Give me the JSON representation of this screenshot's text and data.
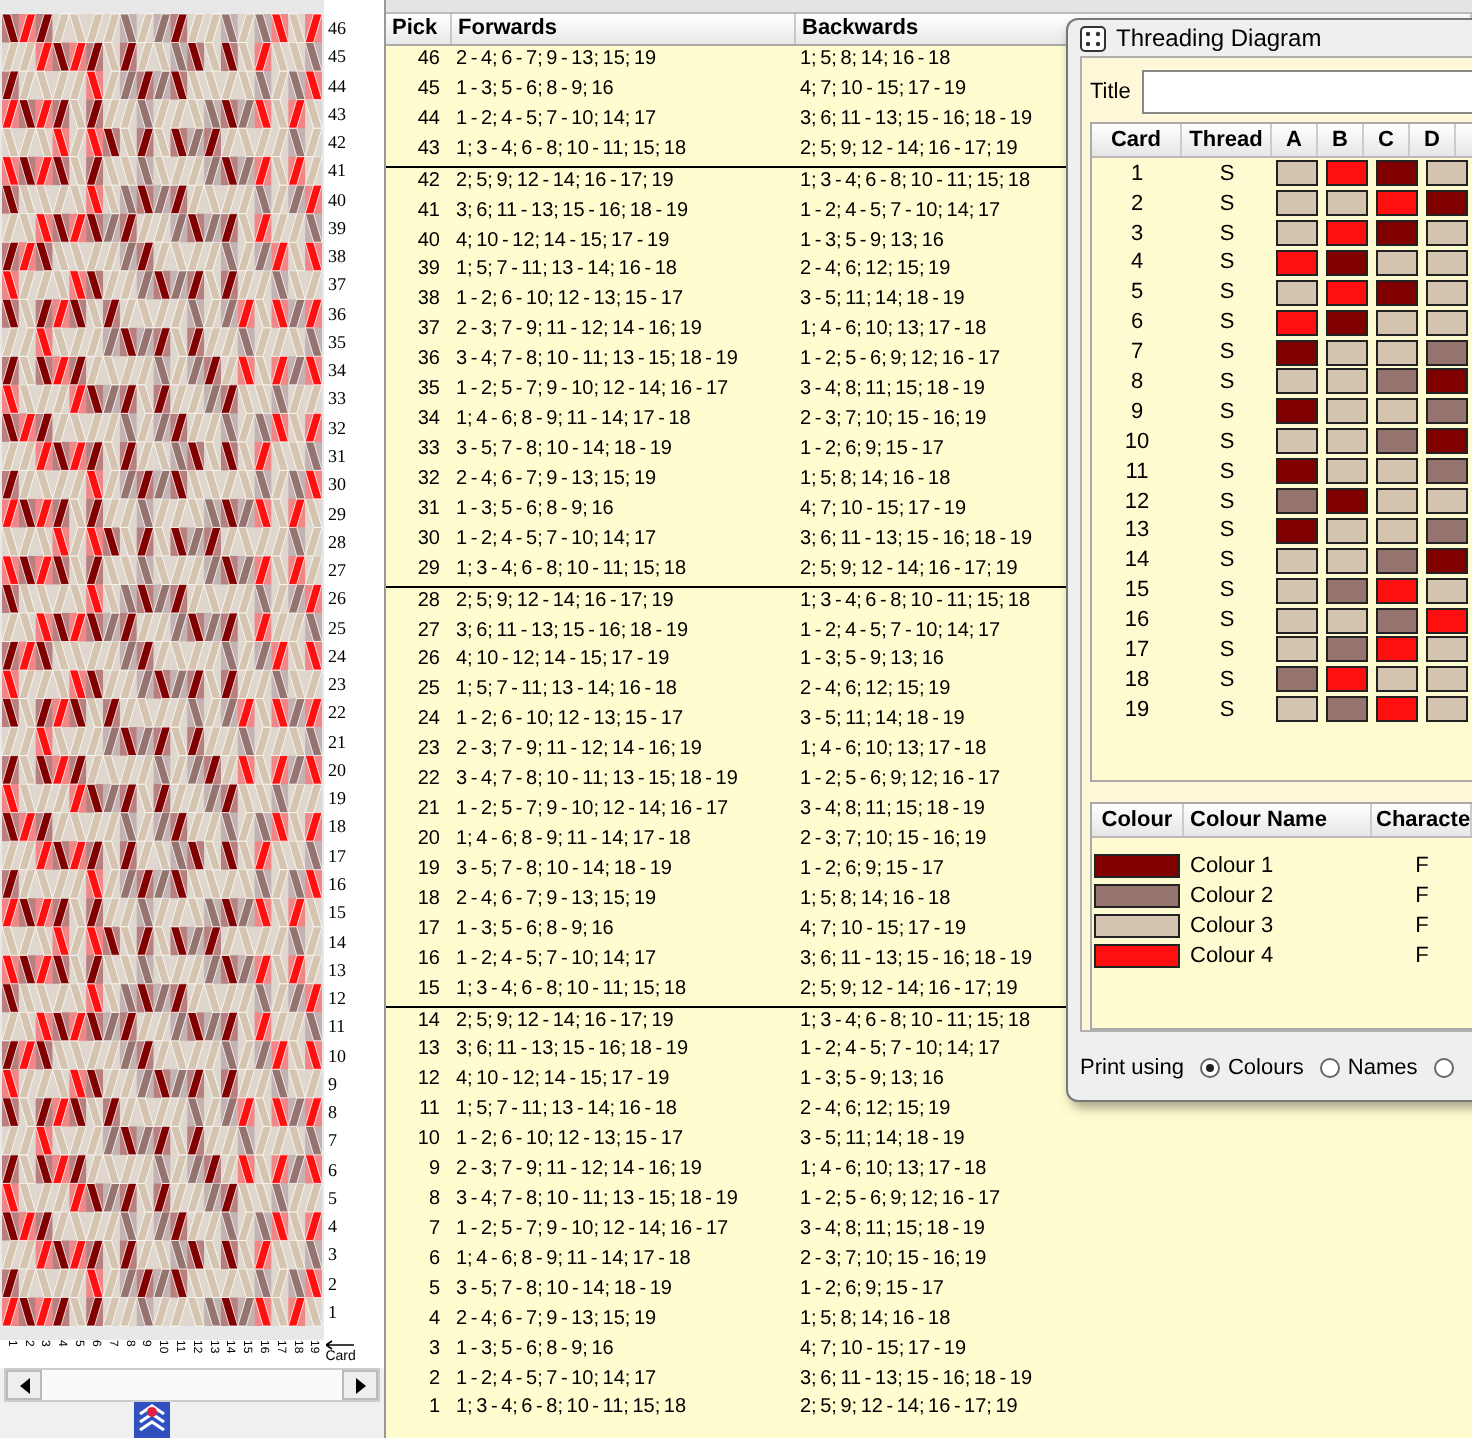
{
  "pattern_panel": {
    "row_labels": [
      "46",
      "45",
      "44",
      "43",
      "42",
      "41",
      "40",
      "39",
      "38",
      "37",
      "36",
      "35",
      "34",
      "33",
      "32",
      "31",
      "30",
      "29",
      "28",
      "27",
      "26",
      "25",
      "24",
      "23",
      "22",
      "21",
      "20",
      "19",
      "18",
      "17",
      "16",
      "15",
      "14",
      "13",
      "12",
      "11",
      "10",
      "9",
      "8",
      "7",
      "6",
      "5",
      "4",
      "3",
      "2",
      "1"
    ],
    "card_labels": [
      "1",
      "2",
      "3",
      "4",
      "5",
      "6",
      "7",
      "8",
      "9",
      "10",
      "11",
      "12",
      "13",
      "14",
      "15",
      "16",
      "17",
      "18",
      "19"
    ],
    "card_axis_label": "Card"
  },
  "pick_table": {
    "columns": [
      "Pick",
      "Forwards",
      "Backwards"
    ],
    "row_groups": [
      [
        {
          "pick": "46",
          "forwards": "2 - 4; 6 - 7; 9 - 13; 15; 19",
          "backwards": "1; 5; 8; 14; 16 - 18"
        },
        {
          "pick": "45",
          "forwards": "1 - 3; 5 - 6; 8 - 9; 16",
          "backwards": "4; 7; 10 - 15; 17 - 19"
        },
        {
          "pick": "44",
          "forwards": "1 - 2; 4 - 5; 7 - 10; 14; 17",
          "backwards": "3; 6; 11 - 13; 15 - 16; 18 - 19"
        },
        {
          "pick": "43",
          "forwards": "1; 3 - 4; 6 - 8; 10 - 11; 15; 18",
          "backwards": "2; 5; 9; 12 - 14; 16 - 17; 19"
        }
      ],
      [
        {
          "pick": "42",
          "forwards": "2; 5; 9; 12 - 14; 16 - 17; 19",
          "backwards": "1; 3 - 4; 6 - 8; 10 - 11; 15; 18"
        },
        {
          "pick": "41",
          "forwards": "3; 6; 11 - 13; 15 - 16; 18 - 19",
          "backwards": "1 - 2; 4 - 5; 7 - 10; 14; 17"
        },
        {
          "pick": "40",
          "forwards": "4; 10 - 12; 14 - 15; 17 - 19",
          "backwards": "1 - 3; 5 - 9; 13; 16"
        },
        {
          "pick": "39",
          "forwards": "1; 5; 7 - 11; 13 - 14; 16 - 18",
          "backwards": "2 - 4; 6; 12; 15; 19"
        },
        {
          "pick": "38",
          "forwards": "1 - 2; 6 - 10; 12 - 13; 15 - 17",
          "backwards": "3 - 5; 11; 14; 18 - 19"
        },
        {
          "pick": "37",
          "forwards": "2 - 3; 7 - 9; 11 - 12; 14 - 16; 19",
          "backwards": "1; 4 - 6; 10; 13; 17 - 18"
        },
        {
          "pick": "36",
          "forwards": "3 - 4; 7 - 8; 10 - 11; 13 - 15; 18 - 19",
          "backwards": "1 - 2; 5 - 6; 9; 12; 16 - 17"
        },
        {
          "pick": "35",
          "forwards": "1 - 2; 5 - 7; 9 - 10; 12 - 14; 16 - 17",
          "backwards": "3 - 4; 8; 11; 15; 18 - 19"
        },
        {
          "pick": "34",
          "forwards": "1; 4 - 6; 8 - 9; 11 - 14; 17 - 18",
          "backwards": "2 - 3; 7; 10; 15 - 16; 19"
        },
        {
          "pick": "33",
          "forwards": "3 - 5; 7 - 8; 10 - 14; 18 - 19",
          "backwards": "1 - 2; 6; 9; 15 - 17"
        },
        {
          "pick": "32",
          "forwards": "2 - 4; 6 - 7; 9 - 13; 15; 19",
          "backwards": "1; 5; 8; 14; 16 - 18"
        },
        {
          "pick": "31",
          "forwards": "1 - 3; 5 - 6; 8 - 9; 16",
          "backwards": "4; 7; 10 - 15; 17 - 19"
        },
        {
          "pick": "30",
          "forwards": "1 - 2; 4 - 5; 7 - 10; 14; 17",
          "backwards": "3; 6; 11 - 13; 15 - 16; 18 - 19"
        },
        {
          "pick": "29",
          "forwards": "1; 3 - 4; 6 - 8; 10 - 11; 15; 18",
          "backwards": "2; 5; 9; 12 - 14; 16 - 17; 19"
        }
      ],
      [
        {
          "pick": "28",
          "forwards": "2; 5; 9; 12 - 14; 16 - 17; 19",
          "backwards": "1; 3 - 4; 6 - 8; 10 - 11; 15; 18"
        },
        {
          "pick": "27",
          "forwards": "3; 6; 11 - 13; 15 - 16; 18 - 19",
          "backwards": "1 - 2; 4 - 5; 7 - 10; 14; 17"
        },
        {
          "pick": "26",
          "forwards": "4; 10 - 12; 14 - 15; 17 - 19",
          "backwards": "1 - 3; 5 - 9; 13; 16"
        },
        {
          "pick": "25",
          "forwards": "1; 5; 7 - 11; 13 - 14; 16 - 18",
          "backwards": "2 - 4; 6; 12; 15; 19"
        },
        {
          "pick": "24",
          "forwards": "1 - 2; 6 - 10; 12 - 13; 15 - 17",
          "backwards": "3 - 5; 11; 14; 18 - 19"
        },
        {
          "pick": "23",
          "forwards": "2 - 3; 7 - 9; 11 - 12; 14 - 16; 19",
          "backwards": "1; 4 - 6; 10; 13; 17 - 18"
        },
        {
          "pick": "22",
          "forwards": "3 - 4; 7 - 8; 10 - 11; 13 - 15; 18 - 19",
          "backwards": "1 - 2; 5 - 6; 9; 12; 16 - 17"
        },
        {
          "pick": "21",
          "forwards": "1 - 2; 5 - 7; 9 - 10; 12 - 14; 16 - 17",
          "backwards": "3 - 4; 8; 11; 15; 18 - 19"
        },
        {
          "pick": "20",
          "forwards": "1; 4 - 6; 8 - 9; 11 - 14; 17 - 18",
          "backwards": "2 - 3; 7; 10; 15 - 16; 19"
        },
        {
          "pick": "19",
          "forwards": "3 - 5; 7 - 8; 10 - 14; 18 - 19",
          "backwards": "1 - 2; 6; 9; 15 - 17"
        },
        {
          "pick": "18",
          "forwards": "2 - 4; 6 - 7; 9 - 13; 15; 19",
          "backwards": "1; 5; 8; 14; 16 - 18"
        },
        {
          "pick": "17",
          "forwards": "1 - 3; 5 - 6; 8 - 9; 16",
          "backwards": "4; 7; 10 - 15; 17 - 19"
        },
        {
          "pick": "16",
          "forwards": "1 - 2; 4 - 5; 7 - 10; 14; 17",
          "backwards": "3; 6; 11 - 13; 15 - 16; 18 - 19"
        },
        {
          "pick": "15",
          "forwards": "1; 3 - 4; 6 - 8; 10 - 11; 15; 18",
          "backwards": "2; 5; 9; 12 - 14; 16 - 17; 19"
        }
      ],
      [
        {
          "pick": "14",
          "forwards": "2; 5; 9; 12 - 14; 16 - 17; 19",
          "backwards": "1; 3 - 4; 6 - 8; 10 - 11; 15; 18"
        },
        {
          "pick": "13",
          "forwards": "3; 6; 11 - 13; 15 - 16; 18 - 19",
          "backwards": "1 - 2; 4 - 5; 7 - 10; 14; 17"
        },
        {
          "pick": "12",
          "forwards": "4; 10 - 12; 14 - 15; 17 - 19",
          "backwards": "1 - 3; 5 - 9; 13; 16"
        },
        {
          "pick": "11",
          "forwards": "1; 5; 7 - 11; 13 - 14; 16 - 18",
          "backwards": "2 - 4; 6; 12; 15; 19"
        },
        {
          "pick": "10",
          "forwards": "1 - 2; 6 - 10; 12 - 13; 15 - 17",
          "backwards": "3 - 5; 11; 14; 18 - 19"
        },
        {
          "pick": "9",
          "forwards": "2 - 3; 7 - 9; 11 - 12; 14 - 16; 19",
          "backwards": "1; 4 - 6; 10; 13; 17 - 18"
        },
        {
          "pick": "8",
          "forwards": "3 - 4; 7 - 8; 10 - 11; 13 - 15; 18 - 19",
          "backwards": "1 - 2; 5 - 6; 9; 12; 16 - 17"
        },
        {
          "pick": "7",
          "forwards": "1 - 2; 5 - 7; 9 - 10; 12 - 14; 16 - 17",
          "backwards": "3 - 4; 8; 11; 15; 18 - 19"
        },
        {
          "pick": "6",
          "forwards": "1; 4 - 6; 8 - 9; 11 - 14; 17 - 18",
          "backwards": "2 - 3; 7; 10; 15 - 16; 19"
        },
        {
          "pick": "5",
          "forwards": "3 - 5; 7 - 8; 10 - 14; 18 - 19",
          "backwards": "1 - 2; 6; 9; 15 - 17"
        },
        {
          "pick": "4",
          "forwards": "2 - 4; 6 - 7; 9 - 13; 15; 19",
          "backwards": "1; 5; 8; 14; 16 - 18"
        },
        {
          "pick": "3",
          "forwards": "1 - 3; 5 - 6; 8 - 9; 16",
          "backwards": "4; 7; 10 - 15; 17 - 19"
        },
        {
          "pick": "2",
          "forwards": "1 - 2; 4 - 5; 7 - 10; 14; 17",
          "backwards": "3; 6; 11 - 13; 15 - 16; 18 - 19"
        },
        {
          "pick": "1",
          "forwards": "1; 3 - 4; 6 - 8; 10 - 11; 15; 18",
          "backwards": "2; 5; 9; 12 - 14; 16 - 17; 19"
        }
      ]
    ]
  },
  "threading_dialog": {
    "title": "Threading Diagram",
    "title_field": {
      "label": "Title"
    },
    "cards_table": {
      "columns": [
        "Card",
        "Thread",
        "A",
        "B",
        "C",
        "D"
      ],
      "rows": [
        {
          "card": "1",
          "thread": "S",
          "holes": [
            {
              "color": "#d4c4b0"
            },
            {
              "color": "#ff1010"
            },
            {
              "color": "#800000"
            },
            {
              "color": "#d4c4b0"
            }
          ]
        },
        {
          "card": "2",
          "thread": "S",
          "holes": [
            {
              "color": "#d4c4b0"
            },
            {
              "color": "#d4c4b0"
            },
            {
              "color": "#ff1010"
            },
            {
              "color": "#800000"
            }
          ]
        },
        {
          "card": "3",
          "thread": "S",
          "holes": [
            {
              "color": "#d4c4b0"
            },
            {
              "color": "#ff1010"
            },
            {
              "color": "#800000"
            },
            {
              "color": "#d4c4b0"
            }
          ]
        },
        {
          "card": "4",
          "thread": "S",
          "holes": [
            {
              "color": "#ff1010"
            },
            {
              "color": "#800000"
            },
            {
              "color": "#d4c4b0"
            },
            {
              "color": "#d4c4b0"
            }
          ]
        },
        {
          "card": "5",
          "thread": "S",
          "holes": [
            {
              "color": "#d4c4b0"
            },
            {
              "color": "#ff1010"
            },
            {
              "color": "#800000"
            },
            {
              "color": "#d4c4b0"
            }
          ]
        },
        {
          "card": "6",
          "thread": "S",
          "holes": [
            {
              "color": "#ff1010"
            },
            {
              "color": "#800000"
            },
            {
              "color": "#d4c4b0"
            },
            {
              "color": "#d4c4b0"
            }
          ]
        },
        {
          "card": "7",
          "thread": "S",
          "holes": [
            {
              "color": "#800000"
            },
            {
              "color": "#d4c4b0"
            },
            {
              "color": "#d4c4b0"
            },
            {
              "color": "#957470"
            }
          ]
        },
        {
          "card": "8",
          "thread": "S",
          "holes": [
            {
              "color": "#d4c4b0"
            },
            {
              "color": "#d4c4b0"
            },
            {
              "color": "#957470"
            },
            {
              "color": "#800000"
            }
          ]
        },
        {
          "card": "9",
          "thread": "S",
          "holes": [
            {
              "color": "#800000"
            },
            {
              "color": "#d4c4b0"
            },
            {
              "color": "#d4c4b0"
            },
            {
              "color": "#957470"
            }
          ]
        },
        {
          "card": "10",
          "thread": "S",
          "holes": [
            {
              "color": "#d4c4b0"
            },
            {
              "color": "#d4c4b0"
            },
            {
              "color": "#957470"
            },
            {
              "color": "#800000"
            }
          ]
        },
        {
          "card": "11",
          "thread": "S",
          "holes": [
            {
              "color": "#800000"
            },
            {
              "color": "#d4c4b0"
            },
            {
              "color": "#d4c4b0"
            },
            {
              "color": "#957470"
            }
          ]
        },
        {
          "card": "12",
          "thread": "S",
          "holes": [
            {
              "color": "#957470"
            },
            {
              "color": "#800000"
            },
            {
              "color": "#d4c4b0"
            },
            {
              "color": "#d4c4b0"
            }
          ]
        },
        {
          "card": "13",
          "thread": "S",
          "holes": [
            {
              "color": "#800000"
            },
            {
              "color": "#d4c4b0"
            },
            {
              "color": "#d4c4b0"
            },
            {
              "color": "#957470"
            }
          ]
        },
        {
          "card": "14",
          "thread": "S",
          "holes": [
            {
              "color": "#d4c4b0"
            },
            {
              "color": "#d4c4b0"
            },
            {
              "color": "#957470"
            },
            {
              "color": "#800000"
            }
          ]
        },
        {
          "card": "15",
          "thread": "S",
          "holes": [
            {
              "color": "#d4c4b0"
            },
            {
              "color": "#957470"
            },
            {
              "color": "#ff1010"
            },
            {
              "color": "#d4c4b0"
            }
          ]
        },
        {
          "card": "16",
          "thread": "S",
          "holes": [
            {
              "color": "#d4c4b0"
            },
            {
              "color": "#d4c4b0"
            },
            {
              "color": "#957470"
            },
            {
              "color": "#ff1010"
            }
          ]
        },
        {
          "card": "17",
          "thread": "S",
          "holes": [
            {
              "color": "#d4c4b0"
            },
            {
              "color": "#957470"
            },
            {
              "color": "#ff1010"
            },
            {
              "color": "#d4c4b0"
            }
          ]
        },
        {
          "card": "18",
          "thread": "S",
          "holes": [
            {
              "color": "#957470"
            },
            {
              "color": "#ff1010"
            },
            {
              "color": "#d4c4b0"
            },
            {
              "color": "#d4c4b0"
            }
          ]
        },
        {
          "card": "19",
          "thread": "S",
          "holes": [
            {
              "color": "#d4c4b0"
            },
            {
              "color": "#957470"
            },
            {
              "color": "#ff1010"
            },
            {
              "color": "#d4c4b0"
            }
          ]
        }
      ]
    },
    "colour_table": {
      "columns": [
        "Colour",
        "Colour Name",
        "Characte"
      ],
      "rows": [
        {
          "color": "#800000",
          "name": "Colour 1",
          "character": "F"
        },
        {
          "color": "#957470",
          "name": "Colour 2",
          "character": "F"
        },
        {
          "color": "#d4c4b0",
          "name": "Colour 3",
          "character": "F"
        },
        {
          "color": "#ff1010",
          "name": "Colour 4",
          "character": "F"
        }
      ]
    },
    "print_using": {
      "label": "Print using",
      "options": [
        {
          "label": "Colours",
          "selected": true
        },
        {
          "label": "Names",
          "selected": false
        },
        {
          "selected": false
        }
      ]
    }
  }
}
